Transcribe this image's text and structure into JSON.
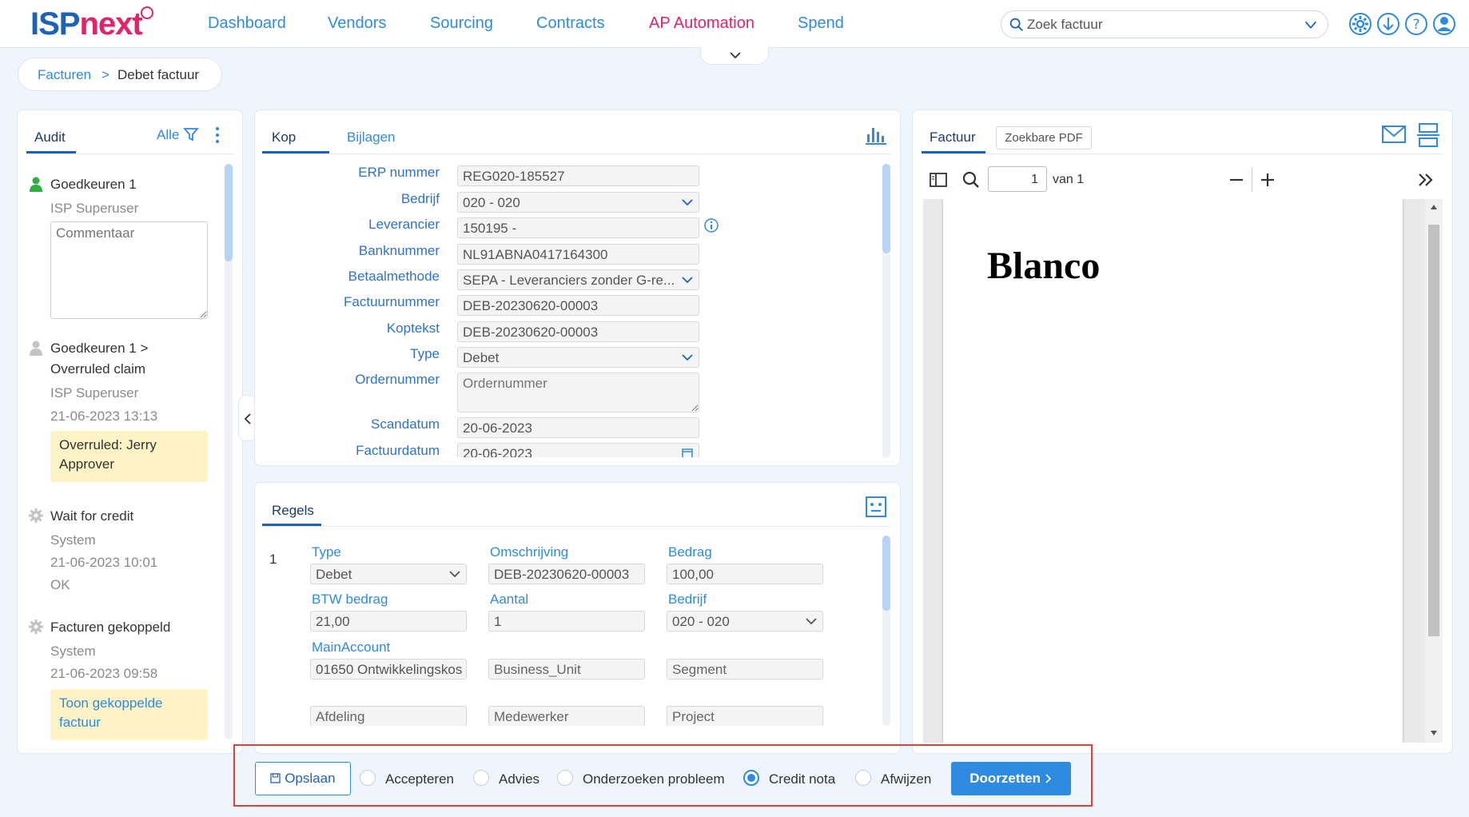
{
  "logo": {
    "part1": "ISP",
    "part2": "next"
  },
  "nav": [
    "Dashboard",
    "Vendors",
    "Sourcing",
    "Contracts",
    "AP Automation",
    "Spend"
  ],
  "search": {
    "placeholder": "Zoek factuur"
  },
  "breadcrumb": {
    "parent": "Facturen",
    "separator": ">",
    "current": "Debet factuur"
  },
  "audit": {
    "tab": "Audit",
    "filter": "Alle",
    "comment_placeholder": "Commentaar",
    "items": [
      {
        "title": "Goedkeuren 1",
        "user": "ISP Superuser"
      },
      {
        "title_line1": "Goedkeuren 1 >",
        "title_line2": "Overruled claim",
        "user": "ISP Superuser",
        "time": "21-06-2023 13:13",
        "note_line1": "Overruled: Jerry",
        "note_line2": "Approver"
      },
      {
        "title": "Wait for credit",
        "user": "System",
        "time": "21-06-2023 10:01",
        "status": "OK"
      },
      {
        "title": "Facturen gekoppeld",
        "user": "System",
        "time": "21-06-2023 09:58",
        "link_line1": "Toon gekoppelde",
        "link_line2": "factuur"
      }
    ]
  },
  "kop": {
    "tabs": [
      "Kop",
      "Bijlagen"
    ],
    "fields": [
      {
        "label": "ERP nummer",
        "value": "REG020-185527"
      },
      {
        "label": "Bedrijf",
        "value": "020 - 020"
      },
      {
        "label": "Leverancier",
        "value": "150195 -"
      },
      {
        "label": "Banknummer",
        "value": "NL91ABNA0417164300"
      },
      {
        "label": "Betaalmethode",
        "value": "SEPA - Leveranciers zonder G-re..."
      },
      {
        "label": "Factuurnummer",
        "value": "DEB-20230620-00003"
      },
      {
        "label": "Koptekst",
        "value": "DEB-20230620-00003"
      },
      {
        "label": "Type",
        "value": "Debet"
      },
      {
        "label": "Ordernummer",
        "placeholder": "Ordernummer"
      },
      {
        "label": "Scandatum",
        "value": "20-06-2023"
      },
      {
        "label": "Factuurdatum",
        "value": "20-06-2023"
      }
    ]
  },
  "regels": {
    "tab": "Regels",
    "row_number": "1",
    "labels": {
      "type": "Type",
      "omschrijving": "Omschrijving",
      "bedrag": "Bedrag",
      "btw": "BTW bedrag",
      "aantal": "Aantal",
      "bedrijf": "Bedrijf",
      "mainaccount": "MainAccount"
    },
    "values": {
      "type": "Debet",
      "omschrijving": "DEB-20230620-00003",
      "bedrag": "100,00",
      "btw": "21,00",
      "aantal": "1",
      "bedrijf": "020 - 020",
      "mainaccount": "01650 Ontwikkelingskos"
    },
    "placeholders": {
      "business_unit": "Business_Unit",
      "segment": "Segment",
      "afdeling": "Afdeling",
      "medewerker": "Medewerker",
      "project": "Project"
    }
  },
  "factuur": {
    "tabs": [
      "Factuur",
      "Zoekbare PDF"
    ],
    "page": "1",
    "of": "van 1",
    "doc_text": "Blanco"
  },
  "actions": {
    "save": "Opslaan",
    "options": [
      "Accepteren",
      "Advies",
      "Onderzoeken probleem",
      "Credit nota",
      "Afwijzen"
    ],
    "selected": "Credit nota",
    "proceed": "Doorzetten"
  },
  "colors": {
    "brand_blue": "#1d62b8",
    "link_blue": "#2f8be0",
    "brand_pink": "#e3226c",
    "highlight_red": "#e0403a",
    "note_yellow": "#fdf3c4"
  }
}
